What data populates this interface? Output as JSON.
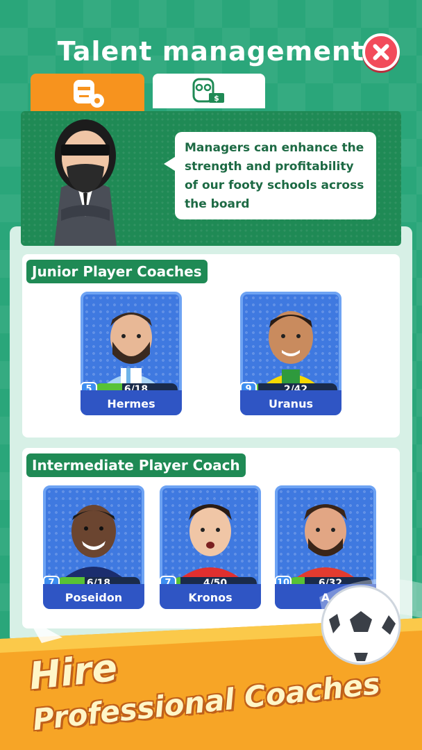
{
  "header": {
    "title": "Talent management"
  },
  "tabs": [
    {
      "icon": "manager-icon",
      "active": true
    },
    {
      "icon": "finance-manager-icon",
      "active": false
    }
  ],
  "banner": {
    "message": "Managers can enhance the strength and profitability of our footy schools across the board"
  },
  "sections": [
    {
      "label": "Junior Player Coaches",
      "coaches": [
        {
          "name": "Hermes",
          "level": "5",
          "progress": "6/18",
          "fill": 0.33
        },
        {
          "name": "Uranus",
          "level": "9",
          "progress": "2/42",
          "fill": 0.05
        }
      ]
    },
    {
      "label": "Intermediate Player Coach",
      "coaches": [
        {
          "name": "Poseidon",
          "level": "7",
          "progress": "6/18",
          "fill": 0.33
        },
        {
          "name": "Kronos",
          "level": "7",
          "progress": "4/50",
          "fill": 0.08
        },
        {
          "name": "A",
          "level": "10",
          "progress": "6/32",
          "fill": 0.19
        }
      ]
    }
  ],
  "promo": {
    "line1": "Hire",
    "line2": "Professional Coaches"
  },
  "colors": {
    "accent": "#f7931e",
    "green": "#1f8a55",
    "card_blue": "#3f79e0",
    "close_red": "#f24b5b"
  }
}
